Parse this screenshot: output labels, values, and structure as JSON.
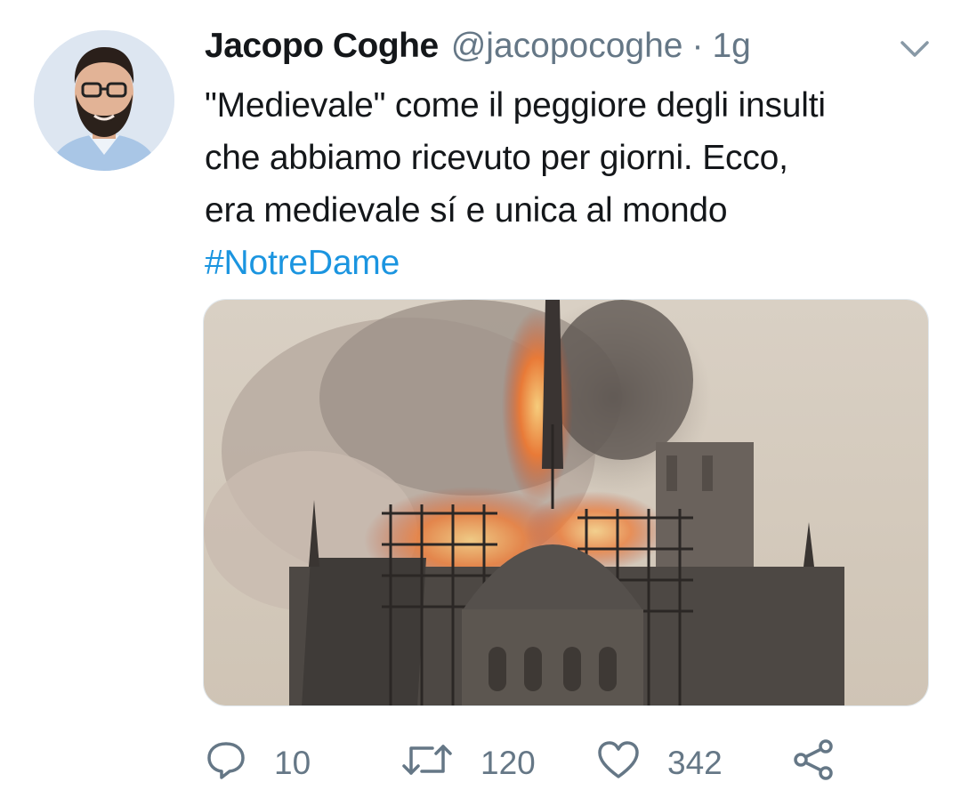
{
  "tweet": {
    "author": {
      "display_name": "Jacopo Coghe",
      "handle": "@jacopocoghe",
      "separator": "·",
      "time": "1g"
    },
    "text": "\"Medievale\" come il peggiore degli insulti\nche abbiamo ricevuto per giorni. Ecco,\nera medievale sí e unica al mondo",
    "hashtag": "#NotreDame",
    "media": {
      "description_icon": "notre-dame-fire-photo"
    },
    "actions": {
      "reply_count": "10",
      "retweet_count": "120",
      "like_count": "342"
    }
  },
  "colors": {
    "text": "#14171a",
    "secondary": "#657786",
    "link": "#1b95e0"
  },
  "icons": {
    "reply": "speech-bubble-icon",
    "retweet": "retweet-arrows-icon",
    "like": "heart-outline-icon",
    "share": "share-nodes-icon",
    "caret": "chevron-down-icon"
  }
}
